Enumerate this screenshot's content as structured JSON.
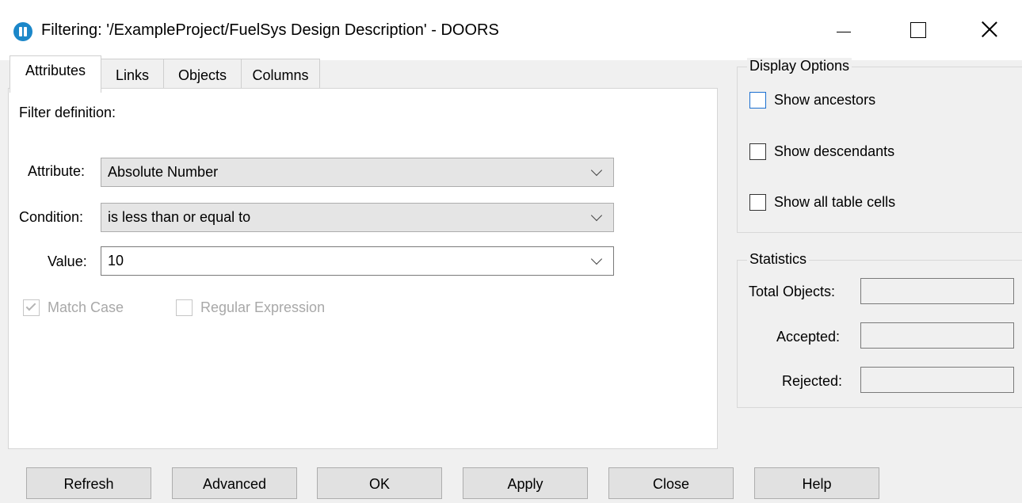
{
  "window": {
    "title": "Filtering: '/ExampleProject/FuelSys Design Description' - DOORS",
    "icon": "doors-app-icon"
  },
  "tabs": [
    {
      "label": "Attributes",
      "active": true
    },
    {
      "label": "Links",
      "active": false
    },
    {
      "label": "Objects",
      "active": false
    },
    {
      "label": "Columns",
      "active": false
    }
  ],
  "filter": {
    "definition_label": "Filter definition:",
    "attribute_label": "Attribute:",
    "attribute_value": "Absolute Number",
    "condition_label": "Condition:",
    "condition_value": "is less than or equal to",
    "value_label": "Value:",
    "value_value": "10",
    "match_case": {
      "label": "Match Case",
      "checked": true,
      "enabled": false
    },
    "regex": {
      "label": "Regular Expression",
      "checked": false,
      "enabled": false
    }
  },
  "display_options": {
    "title": "Display Options",
    "show_ancestors": {
      "label": "Show ancestors",
      "checked": false
    },
    "show_descendants": {
      "label": "Show descendants",
      "checked": false
    },
    "show_all_cells": {
      "label": "Show all table cells",
      "checked": false
    }
  },
  "statistics": {
    "title": "Statistics",
    "total_label": "Total Objects:",
    "accepted_label": "Accepted:",
    "rejected_label": "Rejected:",
    "total_value": "",
    "accepted_value": "",
    "rejected_value": ""
  },
  "buttons": {
    "refresh": "Refresh",
    "advanced": "Advanced",
    "ok": "OK",
    "apply": "Apply",
    "close": "Close",
    "help": "Help"
  },
  "colors": {
    "accent": "#1b87c9",
    "focus": "#1b6fd0",
    "dialog_bg": "#f0f0f0"
  }
}
